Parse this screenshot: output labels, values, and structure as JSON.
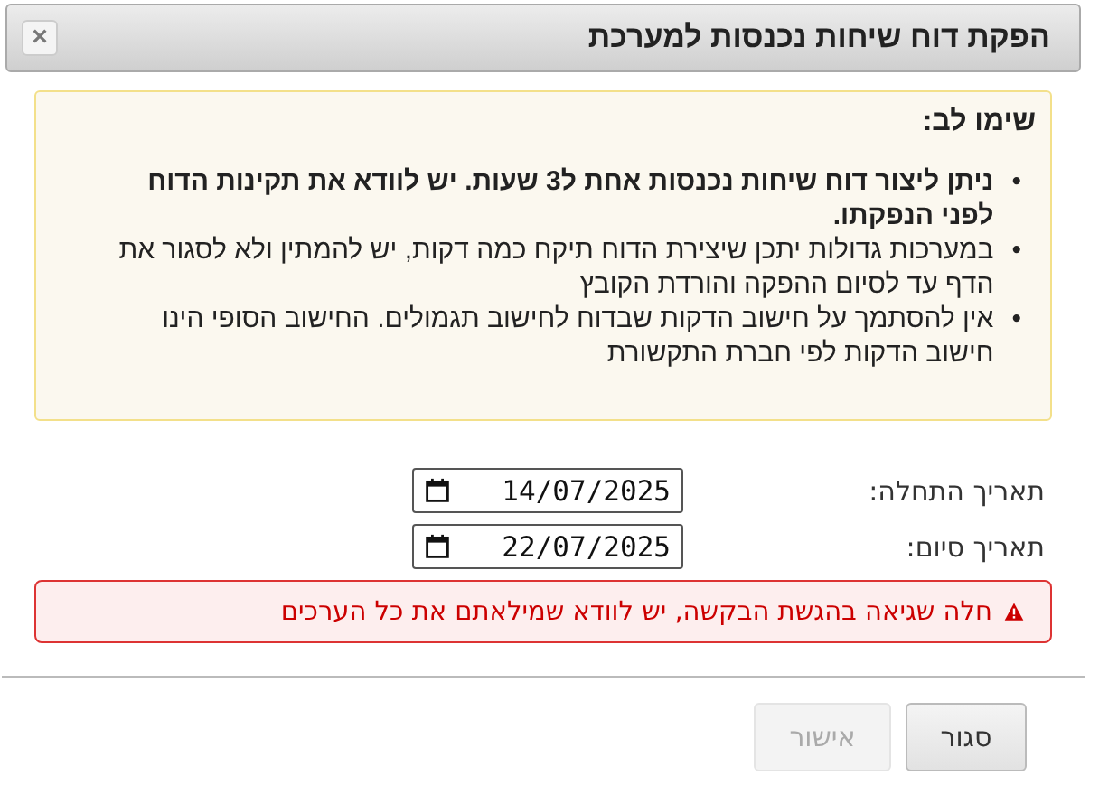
{
  "dialog": {
    "title": "הפקת דוח שיחות נכנסות למערכת",
    "close_icon": "×"
  },
  "notice": {
    "heading": "שימו לב:",
    "items": [
      {
        "bullet": "•",
        "text": "ניתן ליצור דוח שיחות נכנסות אחת ל3 שעות. יש לוודא את תקינות הדוח לפני הנפקתו.",
        "bold": true
      },
      {
        "bullet": "•",
        "text": "במערכות גדולות יתכן שיצירת הדוח תיקח כמה דקות, יש להמתין ולא לסגור את הדף עד לסיום ההפקה והורדת הקובץ",
        "bold": false
      },
      {
        "bullet": "•",
        "text": "אין להסתמך על חישוב הדקות שבדוח לחישוב תגמולים. החישוב הסופי הינו חישוב הדקות לפי חברת התקשורת",
        "bold": false
      }
    ]
  },
  "fields": [
    {
      "label": "תאריך התחלה:",
      "value": "14/07/2025"
    },
    {
      "label": "תאריך סיום:",
      "value": "22/07/2025"
    }
  ],
  "error": {
    "text": "חלה שגיאה בהגשת הבקשה, יש לוודא שמילאתם את כל הערכים"
  },
  "buttons": [
    {
      "label": "סגור",
      "disabled": false
    },
    {
      "label": "אישור",
      "disabled": true
    }
  ]
}
